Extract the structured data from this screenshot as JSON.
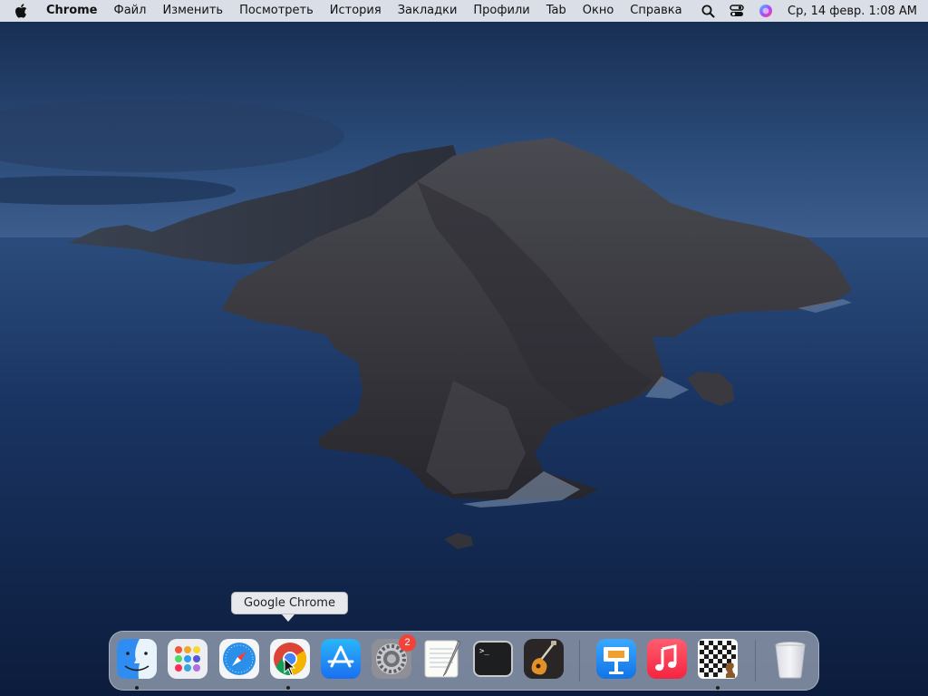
{
  "menubar": {
    "app_name": "Chrome",
    "menus": [
      "Файл",
      "Изменить",
      "Посмотреть",
      "История",
      "Закладки",
      "Профили",
      "Tab",
      "Окно",
      "Справка"
    ],
    "clock": "Ср, 14 февр.  1:08 AM",
    "status_icons": [
      "search-icon",
      "control-center-icon",
      "siri-icon"
    ]
  },
  "tooltip": {
    "text": "Google Chrome"
  },
  "dock": {
    "apps": [
      {
        "name": "finder",
        "icon": "finder-icon",
        "running": true
      },
      {
        "name": "launchpad",
        "icon": "launchpad-icon",
        "running": false
      },
      {
        "name": "safari",
        "icon": "safari-icon",
        "running": false
      },
      {
        "name": "google-chrome",
        "icon": "chrome-icon",
        "running": true
      },
      {
        "name": "app-store",
        "icon": "app-store-icon",
        "running": false
      },
      {
        "name": "system-preferences",
        "icon": "system-preferences-icon",
        "running": false,
        "badge": "2"
      },
      {
        "name": "textedit",
        "icon": "textedit-icon",
        "running": false
      },
      {
        "name": "terminal",
        "icon": "terminal-icon",
        "running": false
      },
      {
        "name": "garageband",
        "icon": "garageband-icon",
        "running": false
      },
      {
        "name": "keynote",
        "icon": "keynote-icon",
        "running": false
      },
      {
        "name": "music",
        "icon": "music-icon",
        "running": false
      },
      {
        "name": "chess",
        "icon": "chess-icon",
        "running": true
      },
      {
        "name": "trash",
        "icon": "trash-icon",
        "running": false
      }
    ]
  },
  "colors": {
    "sky": "#1f3b66",
    "sea": "#13294d",
    "menubar": "#eceef3",
    "badge": "#f0443a"
  }
}
